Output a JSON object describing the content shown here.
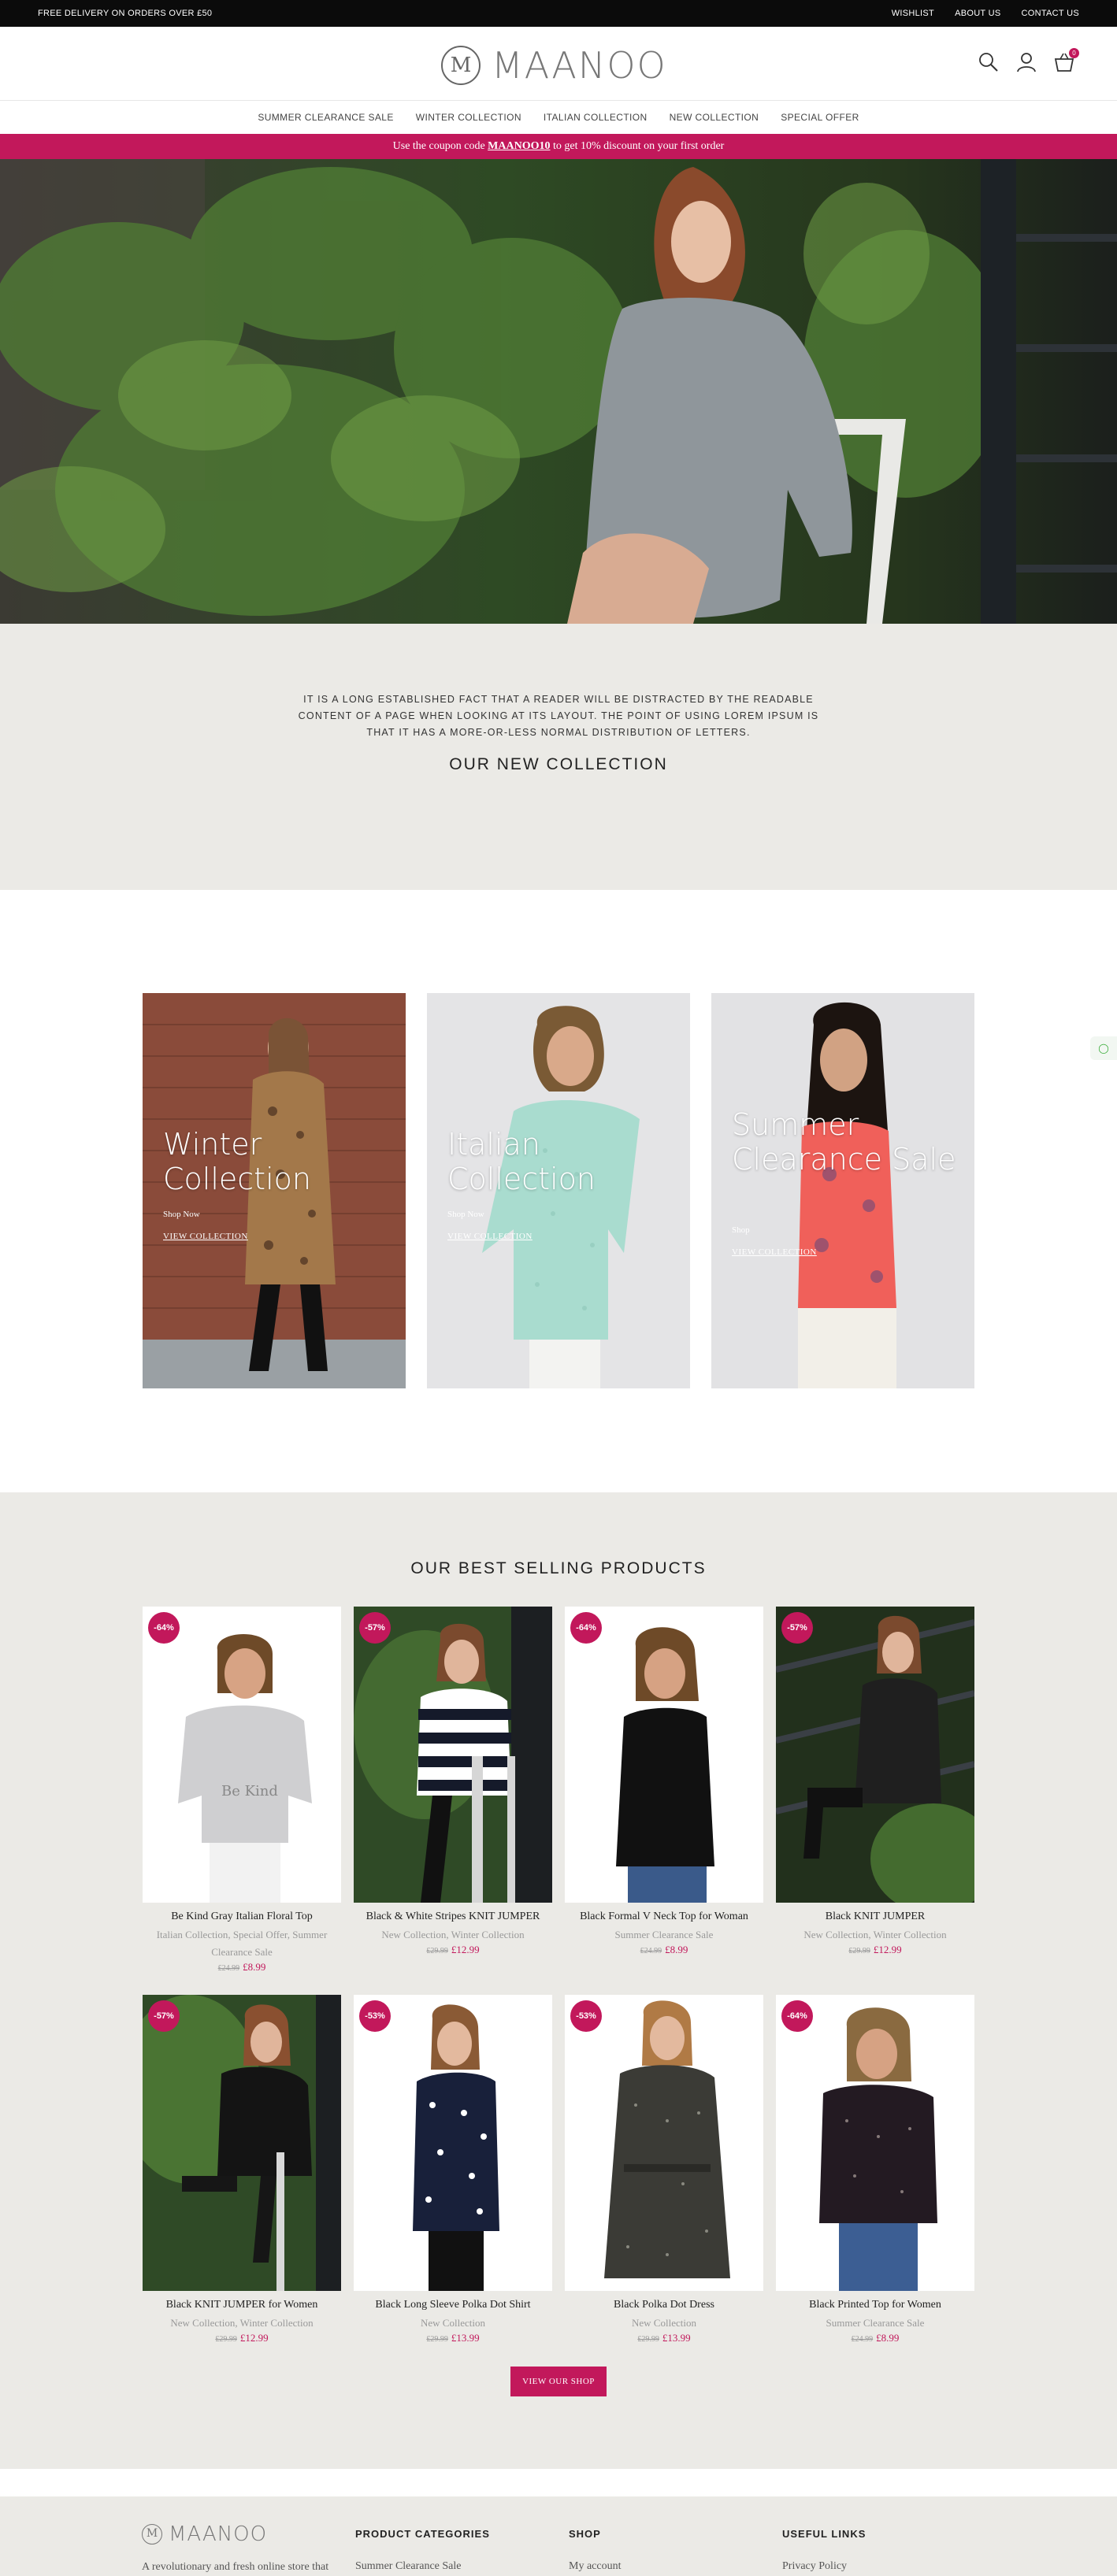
{
  "topbar": {
    "promo": "FREE DELIVERY ON ORDERS OVER £50",
    "links": [
      "WISHLIST",
      "ABOUT US",
      "CONTACT US"
    ]
  },
  "header": {
    "logo_text": "MAANOO",
    "logo_mark": "M",
    "icons": [
      "search-icon",
      "user-icon",
      "cart-icon"
    ],
    "cart_count": "0"
  },
  "nav": [
    "SUMMER CLEARANCE SALE",
    "WINTER COLLECTION",
    "ITALIAN COLLECTION",
    "NEW COLLECTION",
    "SPECIAL OFFER"
  ],
  "coupon": {
    "before": "Use the coupon code ",
    "code": "MAANOO10",
    "after": " to get 10% discount on your first order"
  },
  "intro": {
    "text": "It is a long established fact that a reader will be distracted by the readable content of a page when looking at its layout. The point of using Lorem Ipsum is that it has a more-or-less normal distribution of letters.",
    "heading": "OUR NEW COLLECTION"
  },
  "collections": [
    {
      "title": "Winter Collection",
      "shop": "Shop Now",
      "view": "VIEW COLLECTION"
    },
    {
      "title": "Italian Collection",
      "shop": "Shop Now",
      "view": "VIEW COLLECTION"
    },
    {
      "title": "Summer Clearance Sale",
      "shop": "Shop",
      "view": "VIEW COLLECTION"
    }
  ],
  "products_heading": "OUR BEST SELLING PRODUCTS",
  "products": [
    {
      "badge": "-64%",
      "name": "Be Kind Gray Italian Floral Top",
      "cats": "Italian Collection, Special Offer, Summer Clearance Sale",
      "old": "£24.99",
      "price": "£8.99"
    },
    {
      "badge": "-57%",
      "name": "Black & White Stripes KNIT JUMPER",
      "cats": "New Collection, Winter Collection",
      "old": "£29.99",
      "price": "£12.99"
    },
    {
      "badge": "-64%",
      "name": "Black Formal V Neck Top for Woman",
      "cats": "Summer Clearance Sale",
      "old": "£24.99",
      "price": "£8.99"
    },
    {
      "badge": "-57%",
      "name": "Black KNIT JUMPER",
      "cats": "New Collection, Winter Collection",
      "old": "£29.99",
      "price": "£12.99"
    },
    {
      "badge": "-57%",
      "name": "Black KNIT JUMPER for Women",
      "cats": "New Collection, Winter Collection",
      "old": "£29.99",
      "price": "£12.99"
    },
    {
      "badge": "-53%",
      "name": "Black Long Sleeve Polka Dot Shirt",
      "cats": "New Collection",
      "old": "£29.99",
      "price": "£13.99"
    },
    {
      "badge": "-53%",
      "name": "Black Polka Dot Dress",
      "cats": "New Collection",
      "old": "£29.99",
      "price": "£13.99"
    },
    {
      "badge": "-64%",
      "name": "Black Printed Top for Women",
      "cats": "Summer Clearance Sale",
      "old": "£24.99",
      "price": "£8.99"
    }
  ],
  "view_shop": "VIEW OUR SHOP",
  "footer": {
    "logo_text": "MAANOO",
    "tagline": "A revolutionary and fresh online store that",
    "columns": [
      {
        "title": "PRODUCT CATEGORIES",
        "first": "Summer Clearance Sale"
      },
      {
        "title": "SHOP",
        "first": "My account"
      },
      {
        "title": "USEFUL LINKS",
        "first": "Privacy Policy"
      }
    ]
  },
  "colors": {
    "accent": "#c2185b",
    "topbar": "#0b0b0b",
    "section_bg": "#ebeae6"
  }
}
